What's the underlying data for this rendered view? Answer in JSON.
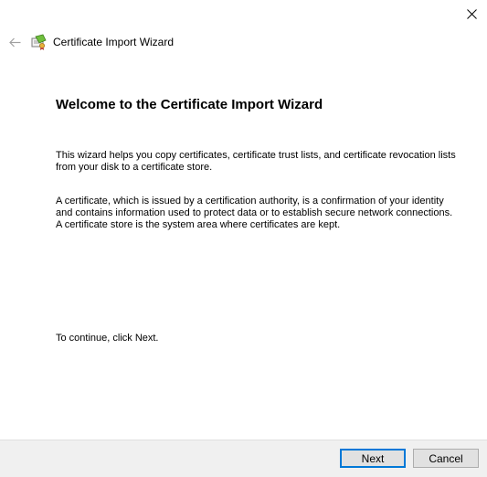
{
  "window": {
    "title": "Certificate Import Wizard"
  },
  "icons": {
    "close": "close-icon",
    "back": "back-arrow-icon",
    "app": "certificate-icon"
  },
  "main": {
    "heading": "Welcome to the Certificate Import Wizard",
    "paragraph_1": "This wizard helps you copy certificates, certificate trust lists, and certificate revocation lists from your disk to a certificate store.",
    "paragraph_2": "A certificate, which is issued by a certification authority, is a confirmation of your identity and contains information used to protect data or to establish secure network connections. A certificate store is the system area where certificates are kept.",
    "paragraph_3": "To continue, click Next."
  },
  "footer": {
    "next_label": "Next",
    "cancel_label": "Cancel"
  },
  "colors": {
    "accent": "#0078d7",
    "footer_bg": "#f0f0f0",
    "button_bg": "#e1e1e1"
  }
}
